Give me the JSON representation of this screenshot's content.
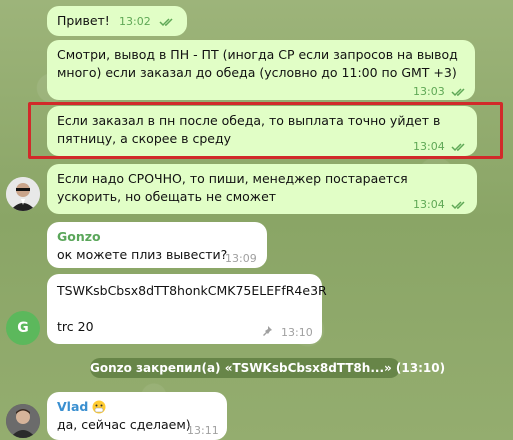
{
  "messages": [
    {
      "text": "Привет!",
      "time": "13:02"
    },
    {
      "text": "Смотри, вывод в ПН - ПТ (иногда СР если запросов на вывод много) если заказал до обеда (условно до 11:00 по GMT +3)",
      "time": "13:03"
    },
    {
      "text": "Если заказал в пн после обеда, то выплата точно уйдет в пятницу, а скорее в среду",
      "time": "13:04"
    },
    {
      "text": "Если надо СРОЧНО, то пиши, менеджер постарается ускорить, но обещать не сможет",
      "time": "13:04"
    },
    {
      "sender": "Gonzo",
      "text": "ок можете плиз вывести?",
      "time": "13:09"
    },
    {
      "text_line1": "TSWKsbCbsx8dTT8honkCMK75ELEFfR4e3R",
      "text_line2": "trc 20",
      "time": "13:10",
      "avatar_letter": "G"
    },
    {
      "sender": "Vlad",
      "text": "да, сейчас сделаем)",
      "time": "13:11"
    }
  ],
  "service_message": "Gonzo закрепил(а) «TSWKsbCbsx8dTT8h...» (13:10)",
  "colors": {
    "outgoing": "#e1fec6",
    "incoming": "#ffffff",
    "highlight": "#d12a2a",
    "gonzo": "#5aa65a",
    "vlad": "#3a8fd0"
  }
}
